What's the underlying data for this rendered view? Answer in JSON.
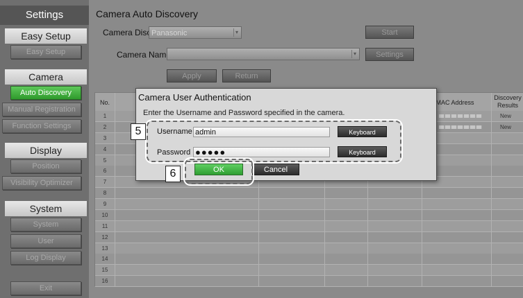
{
  "sidebar": {
    "title": "Settings",
    "sections": [
      {
        "label": "Easy Setup",
        "buttons": [
          "Easy Setup"
        ]
      },
      {
        "label": "Camera",
        "buttons": [
          "Auto Discovery",
          "Manual Registration",
          "Function Settings"
        ]
      },
      {
        "label": "Display",
        "buttons": [
          "Position",
          "Visibility Optimizer"
        ]
      },
      {
        "label": "System",
        "buttons": [
          "System",
          "User",
          "Log Display"
        ]
      }
    ],
    "exit_label": "Exit"
  },
  "main": {
    "title": "Camera Auto Discovery",
    "camera_discovery_label": "Camera Discovery",
    "camera_discovery_value": "Panasonic",
    "start_label": "Start",
    "camera_name_label": "Camera Name",
    "camera_name_value": "",
    "settings_label": "Settings",
    "apply_label": "Apply",
    "return_label": "Return"
  },
  "table": {
    "headers": {
      "no": "No.",
      "mac": "MAC Address",
      "results": "Discovery Results"
    },
    "rows": [
      {
        "no": "1",
        "mac_blurred": true,
        "results": "New"
      },
      {
        "no": "2",
        "mac_blurred": true,
        "results": "New"
      },
      {
        "no": "3",
        "mac_blurred": false,
        "results": ""
      },
      {
        "no": "4",
        "mac_blurred": false,
        "results": ""
      },
      {
        "no": "5",
        "mac_blurred": false,
        "results": ""
      },
      {
        "no": "6",
        "mac_blurred": false,
        "results": ""
      },
      {
        "no": "7",
        "mac_blurred": false,
        "results": ""
      },
      {
        "no": "8",
        "mac_blurred": false,
        "results": ""
      },
      {
        "no": "9",
        "mac_blurred": false,
        "results": ""
      },
      {
        "no": "10",
        "mac_blurred": false,
        "results": ""
      },
      {
        "no": "11",
        "mac_blurred": false,
        "results": ""
      },
      {
        "no": "12",
        "mac_blurred": false,
        "results": ""
      },
      {
        "no": "13",
        "mac_blurred": false,
        "results": ""
      },
      {
        "no": "14",
        "mac_blurred": false,
        "results": ""
      },
      {
        "no": "15",
        "mac_blurred": false,
        "results": ""
      },
      {
        "no": "16",
        "mac_blurred": false,
        "results": ""
      }
    ]
  },
  "dialog": {
    "title": "Camera User Authentication",
    "message": "Enter the Username and Password specified in the camera.",
    "username_label": "Username :",
    "username_value": "admin",
    "password_label": "Password :",
    "password_value": "●●●●●",
    "keyboard_label": "Keyboard",
    "ok_label": "OK",
    "cancel_label": "Cancel"
  },
  "callouts": {
    "credentials": "5",
    "ok": "6"
  },
  "colors": {
    "accent_green": "#3aa83a",
    "callout_border": "#6a6a6a"
  }
}
